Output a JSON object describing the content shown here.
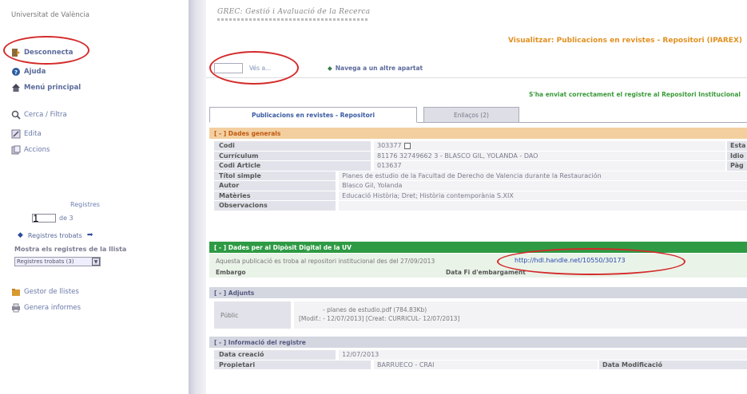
{
  "sidebar": {
    "university": "Universitat de València",
    "links": {
      "logout": "Desconnecta",
      "help": "Ajuda",
      "main_menu": "Menú principal",
      "search": "Cerca / Filtra",
      "edit": "Edita",
      "actions": "Accions"
    },
    "records": {
      "title": "Registres",
      "current": "1",
      "of_label": "de 3",
      "found_label": "Registres trobats"
    },
    "show_list_label": "Mostra els registres de la llista",
    "list_select_value": "Registres trobats (3)",
    "list_manager": "Gestor de llistes",
    "reports": "Genera informes"
  },
  "header": {
    "app_title": "GREC: Gestió i Avaluació de la Recerca",
    "page_title": "Visualitzar: Publicacions en revistes - Repositori (IPAREX)",
    "goto_label": "Vés a...",
    "navigate_label": "Navega a un altre apartat",
    "success_message": "S'ha enviat correctament el registre al Repositori Institucional"
  },
  "tabs": [
    {
      "label": "Publicacions en revistes - Repositori"
    },
    {
      "label": "Enllaços (2)"
    }
  ],
  "general": {
    "title": "[ - ] Dades generals",
    "rows": [
      {
        "label": "Codi",
        "value": "303377",
        "extra": "Esta"
      },
      {
        "label": "Currículum",
        "value": "81176  32749662 3 - BLASCO GIL, YOLANDA - DAO",
        "extra": "Idio"
      },
      {
        "label": "Codi Article",
        "value": "013637",
        "extra": "Pàg"
      },
      {
        "label": "Títol simple",
        "value": "Planes de estudio de la Facultad de Derecho de Valencia durante la Restauración",
        "extra": ""
      },
      {
        "label": "Autor",
        "value": "Blasco Gil, Yolanda",
        "extra": ""
      },
      {
        "label": "Matèries",
        "value": "Educació Història; Dret; Història contemporània S.XIX",
        "extra": ""
      },
      {
        "label": "Observacions",
        "value": "",
        "extra": ""
      }
    ]
  },
  "deposit": {
    "title": "[ - ] Dades per al Dipòsit Digital de la UV",
    "text": "Aquesta publicació es troba al repositori institucional des del 27/09/2013",
    "link": "http://hdl.handle.net/10550/30173",
    "embargo_label": "Embargo",
    "embargo_end_label": "Data Fi d'embargament"
  },
  "attachments": {
    "title": "[ - ] Adjunts",
    "type": "Públic",
    "line1": "- planes de estudio.pdf (784.83Kb)",
    "line2": "[Modif.: - 12/07/2013] [Creat: CURRICUL- 12/07/2013]"
  },
  "record_info": {
    "title": "[ - ] Informació del registre",
    "rows": [
      {
        "label": "Data creació",
        "value": "12/07/2013",
        "extra": ""
      },
      {
        "label": "Propietari",
        "value": "BARRUECO - CRAI",
        "extra": "Data Modificació"
      }
    ]
  },
  "colors": {
    "annotation_red": "#d42a2a",
    "orange_title": "#e19020",
    "green_section": "#2e9a44",
    "link_blue": "#2a4ab0"
  }
}
